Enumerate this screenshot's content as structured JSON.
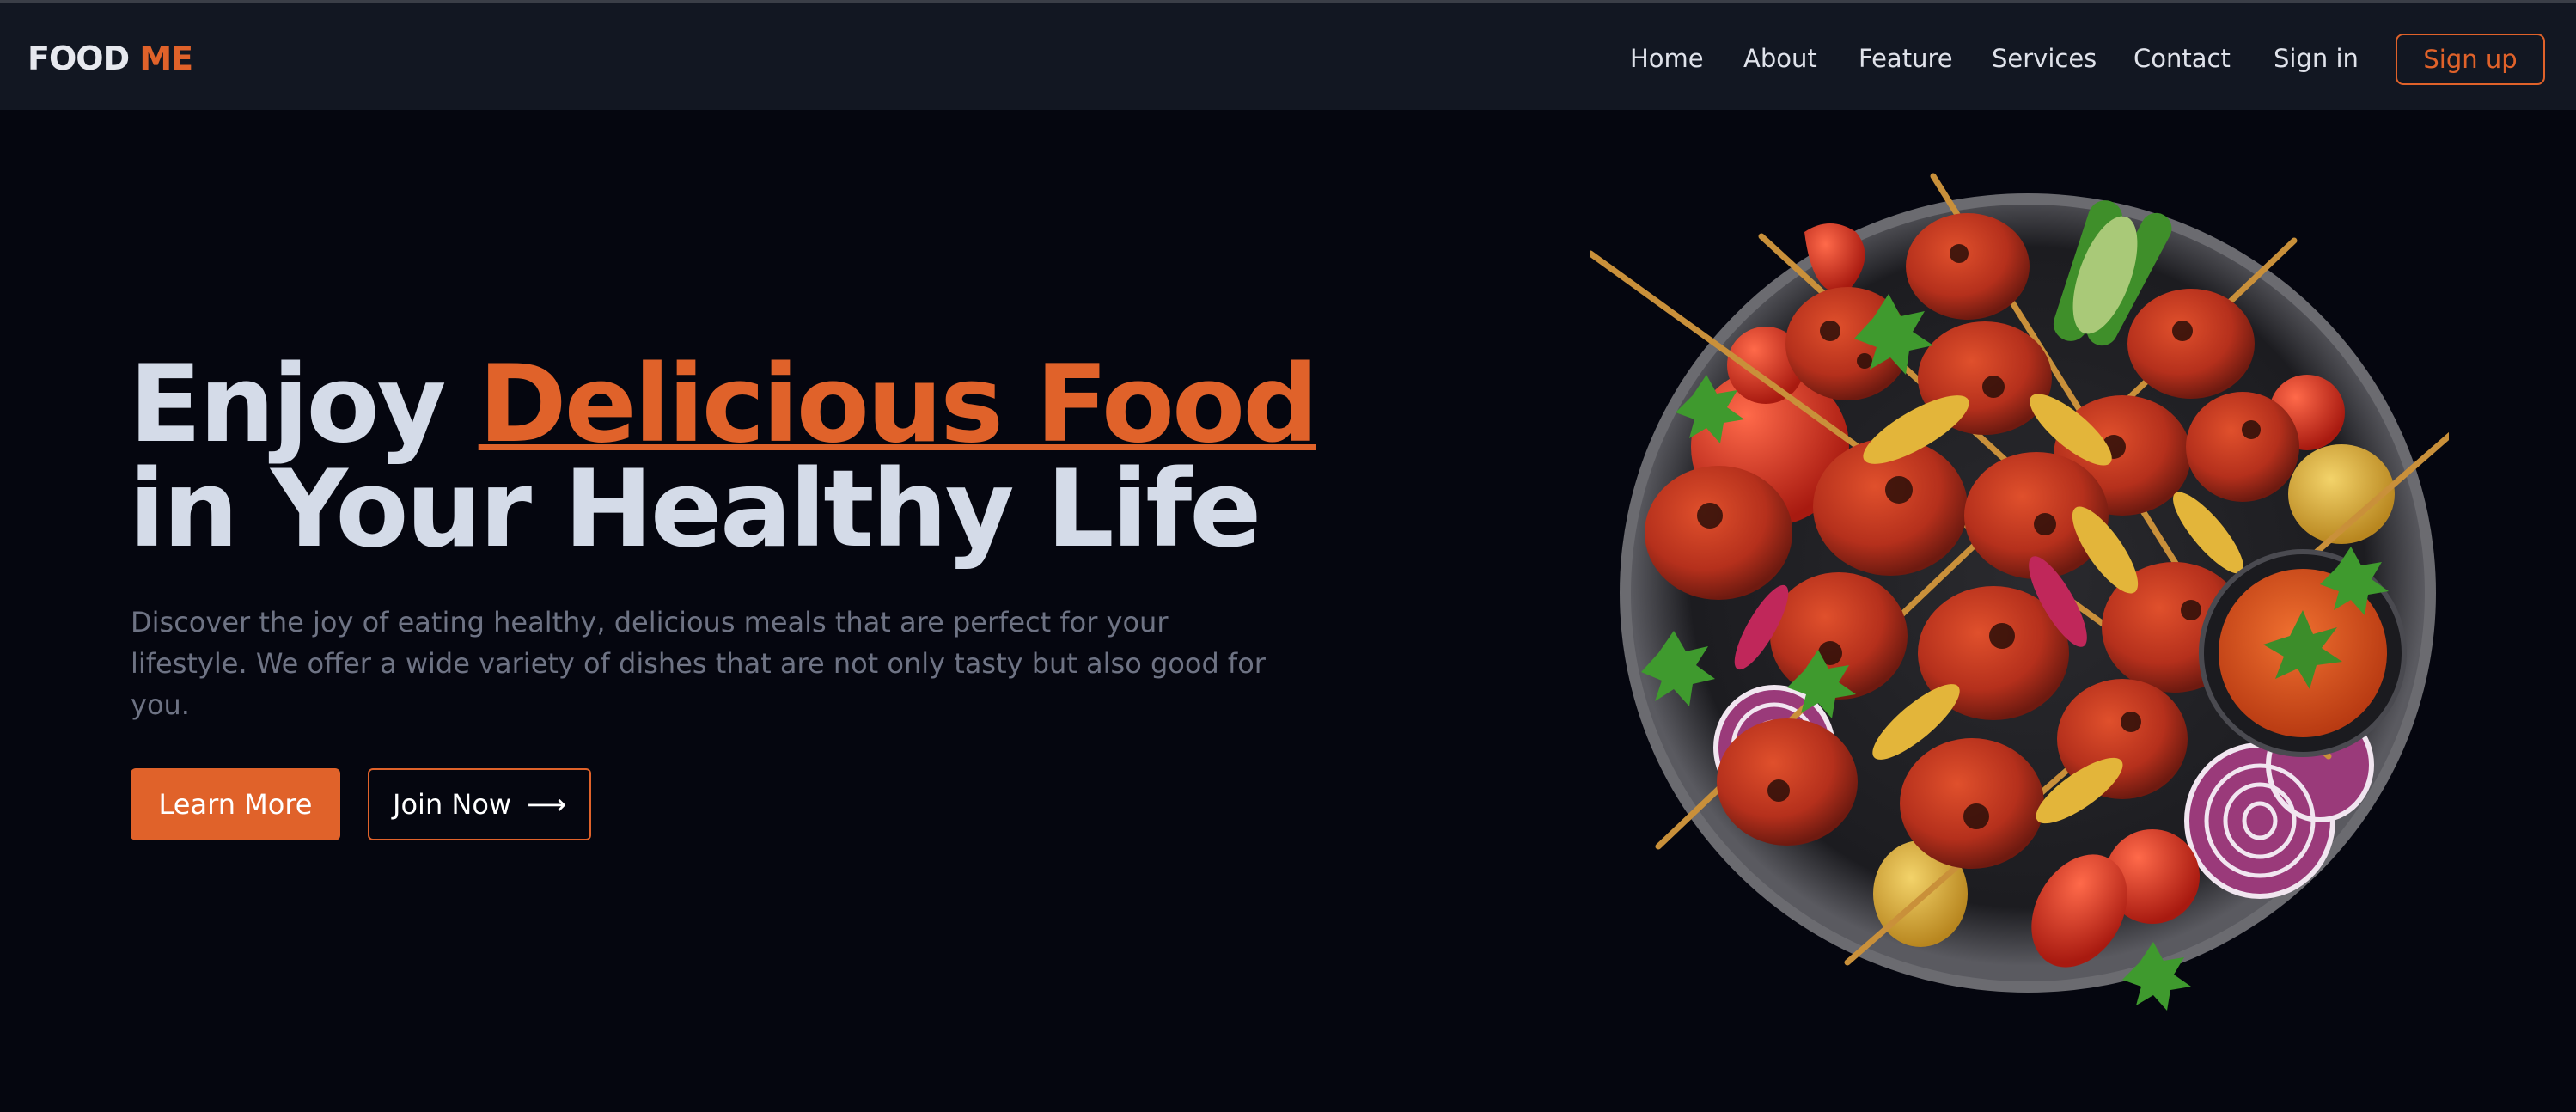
{
  "navbar": {
    "logo_main": "FOOD",
    "logo_accent": "ME",
    "links": [
      "Home",
      "About",
      "Feature",
      "Services",
      "Contact",
      "Sign in"
    ],
    "signup_label": "Sign up"
  },
  "hero": {
    "title_pre": "Enjoy",
    "title_highlight": "Delicious Food",
    "title_line2": "in Your Healthy Life",
    "description": "Discover the joy of eating healthy, delicious meals that are perfect for your lifestyle. We offer a wide variety of dishes that are not only tasty but also good for you.",
    "learn_more_label": "Learn More",
    "join_now_label": "Join Now",
    "join_icon": "arrow-right-icon"
  },
  "image": {
    "subject": "food-plate-image",
    "alt": ""
  },
  "colors": {
    "accent": "#e0622a",
    "background": "#05060f",
    "navbar": "#121722",
    "title": "#d4dbe8",
    "muted_text": "#6e7384"
  }
}
